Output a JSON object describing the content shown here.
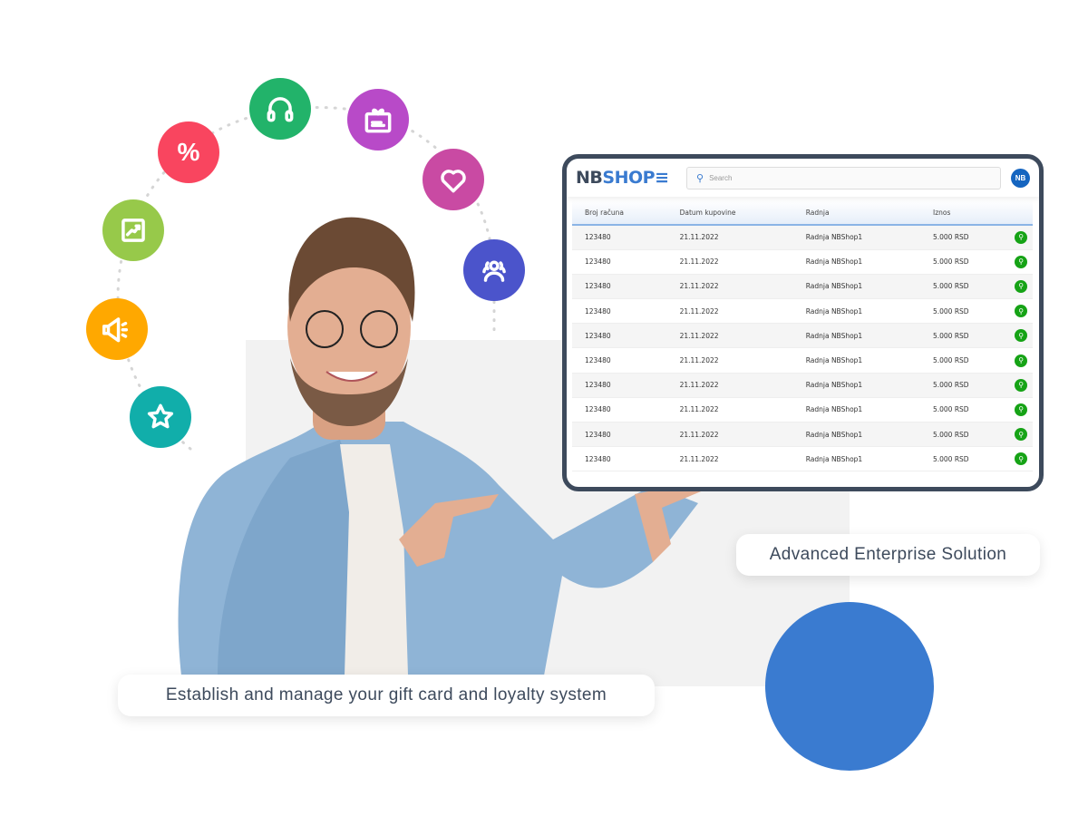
{
  "colors": {
    "accent": "#3a7bd0",
    "frame": "#3d4a5c",
    "action": "#16a316"
  },
  "feature_icons": [
    {
      "name": "percent-icon",
      "glyph": "%",
      "color": "#f9455f"
    },
    {
      "name": "headphones-icon",
      "color": "#22b36a"
    },
    {
      "name": "gift-card-icon",
      "color": "#b84ac8"
    },
    {
      "name": "heart-icon",
      "color": "#c94aa3"
    },
    {
      "name": "users-icon",
      "color": "#4b54cb"
    },
    {
      "name": "chart-icon",
      "color": "#97c94a"
    },
    {
      "name": "megaphone-icon",
      "color": "#ffa800"
    },
    {
      "name": "star-icon",
      "color": "#11aeaa"
    }
  ],
  "app": {
    "logo_dark": "NB",
    "logo_blue": "SHOP",
    "search_placeholder": "Search",
    "avatar": "NB",
    "columns": [
      "Broj računa",
      "Datum kupovine",
      "Radnja",
      "Iznos"
    ],
    "rows": [
      [
        "123480",
        "21.11.2022",
        "Radnja NBShop1",
        "5.000 RSD"
      ],
      [
        "123480",
        "21.11.2022",
        "Radnja NBShop1",
        "5.000 RSD"
      ],
      [
        "123480",
        "21.11.2022",
        "Radnja NBShop1",
        "5.000 RSD"
      ],
      [
        "123480",
        "21.11.2022",
        "Radnja NBShop1",
        "5.000 RSD"
      ],
      [
        "123480",
        "21.11.2022",
        "Radnja NBShop1",
        "5.000 RSD"
      ],
      [
        "123480",
        "21.11.2022",
        "Radnja NBShop1",
        "5.000 RSD"
      ],
      [
        "123480",
        "21.11.2022",
        "Radnja NBShop1",
        "5.000 RSD"
      ],
      [
        "123480",
        "21.11.2022",
        "Radnja NBShop1",
        "5.000 RSD"
      ],
      [
        "123480",
        "21.11.2022",
        "Radnja NBShop1",
        "5.000 RSD"
      ],
      [
        "123480",
        "21.11.2022",
        "Radnja NBShop1",
        "5.000 RSD"
      ]
    ]
  },
  "captions": {
    "enterprise": "Advanced Enterprise Solution",
    "gift_card": "Establish and manage your gift card and loyalty system"
  }
}
